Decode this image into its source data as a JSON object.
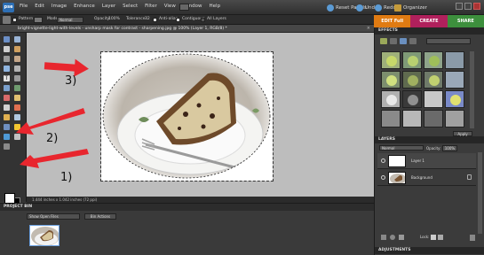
{
  "app": {
    "logo_text": "pse",
    "menu": [
      "File",
      "Edit",
      "Image",
      "Enhance",
      "Layer",
      "Select",
      "Filter",
      "View",
      "Window",
      "Help"
    ],
    "reset_panels": "Reset Panels",
    "undo": "Undo",
    "redo": "Redo",
    "organizer": "Organizer"
  },
  "modes": {
    "edit": "EDIT Full",
    "create": "CREATE",
    "share": "SHARE"
  },
  "options_bar": {
    "pattern": "Pattern",
    "mode_label": "Mode:",
    "mode_value": "Normal",
    "opacity_label": "Opacity:",
    "opacity_value": "100%",
    "tolerance_label": "Tolerance:",
    "tolerance_value": "32",
    "anti_alias": "Anti-alias",
    "contiguous": "Contiguous",
    "all_layers": "All Layers"
  },
  "document": {
    "tab_title": "bright-vignette-light-with-levels - unsharp mask for contrast - sharpening.jpg @ 100% (Layer 1, RGB/8) *",
    "status": "1.444 inches x 1.042 inches (72 ppi)"
  },
  "project_bin": {
    "title": "PROJECT BIN",
    "show_select": "Show Open Files",
    "bin_actions": "Bin Actions"
  },
  "effects": {
    "title": "EFFECTS",
    "apply": "Apply"
  },
  "layers": {
    "title": "LAYERS",
    "blend_mode": "Normal",
    "opacity_label": "Opacity:",
    "opacity_value": "100%",
    "items": [
      {
        "name": "Layer 1",
        "selected": true
      },
      {
        "name": "Background",
        "selected": false,
        "locked": true
      }
    ],
    "lock_label": "Lock:"
  },
  "adjustments": {
    "title": "ADJUSTMENTS"
  },
  "annotations": {
    "label_1": "1)",
    "label_2": "2)",
    "label_3": "3)"
  },
  "colors": {
    "edit_tab": "#e07b12",
    "create_tab": "#b0205c",
    "share_tab": "#3d8f3d",
    "arrow": "#e8262e"
  }
}
